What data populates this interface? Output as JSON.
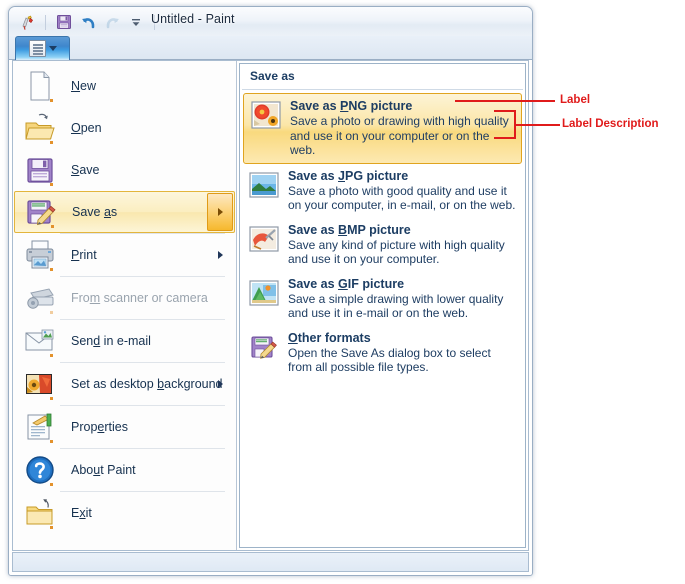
{
  "window": {
    "title": "Untitled - Paint",
    "quick_access": [
      {
        "name": "paint-app-icon",
        "glyph": "paint"
      },
      {
        "name": "save-icon",
        "glyph": "floppy"
      },
      {
        "name": "undo-icon",
        "glyph": "undo"
      },
      {
        "name": "redo-icon",
        "glyph": "redo",
        "disabled": true
      },
      {
        "name": "customize-qat-icon",
        "glyph": "chevron-down"
      }
    ]
  },
  "ribbon": {
    "paint_menu_button_label": ""
  },
  "left_menu": {
    "items": [
      {
        "label": "New",
        "accel": "N",
        "icon": "new-document-icon",
        "submenu": false,
        "disabled": false,
        "separator_after": false
      },
      {
        "label": "Open",
        "accel": "O",
        "icon": "open-folder-icon",
        "submenu": false,
        "disabled": false,
        "separator_after": false
      },
      {
        "label": "Save",
        "accel": "S",
        "icon": "floppy-disk-icon",
        "submenu": false,
        "disabled": false,
        "separator_after": false
      },
      {
        "label": "Save as",
        "accel": "a",
        "icon": "save-as-icon",
        "submenu": true,
        "disabled": false,
        "selected": true,
        "separator_after": true
      },
      {
        "label": "Print",
        "accel": "P",
        "icon": "printer-icon",
        "submenu": true,
        "disabled": false,
        "separator_after": true
      },
      {
        "label": "From scanner or camera",
        "accel": "m",
        "icon": "scanner-icon",
        "submenu": false,
        "disabled": true,
        "separator_after": true
      },
      {
        "label": "Send in e-mail",
        "accel": "d",
        "icon": "email-icon",
        "submenu": false,
        "disabled": false,
        "separator_after": true
      },
      {
        "label": "Set as desktop background",
        "accel": "b",
        "icon": "desktop-background-icon",
        "submenu": true,
        "disabled": false,
        "separator_after": true
      },
      {
        "label": "Properties",
        "accel": "e",
        "icon": "properties-icon",
        "submenu": false,
        "disabled": false,
        "separator_after": true
      },
      {
        "label": "About Paint",
        "accel": "u",
        "icon": "about-help-icon",
        "submenu": false,
        "disabled": false,
        "separator_after": true
      },
      {
        "label": "Exit",
        "accel": "x",
        "icon": "exit-folder-icon",
        "submenu": false,
        "disabled": false,
        "separator_after": false
      }
    ]
  },
  "save_as_panel": {
    "header": "Save as",
    "items": [
      {
        "title": "Save as PNG picture",
        "accel": "P",
        "description": "Save a photo or drawing with high quality and use it on your computer or on the web.",
        "icon": "png-flower-icon",
        "highlighted": true
      },
      {
        "title": "Save as JPG picture",
        "accel": "J",
        "description": "Save a photo with good quality and use it on your computer, in e-mail, or on the web.",
        "icon": "jpg-photo-icon",
        "highlighted": false
      },
      {
        "title": "Save as BMP picture",
        "accel": "B",
        "description": "Save any kind of picture with high quality and use it on your computer.",
        "icon": "bmp-paint-icon",
        "highlighted": false
      },
      {
        "title": "Save as GIF picture",
        "accel": "G",
        "description": "Save a simple drawing with lower quality and use it in e-mail or on the web.",
        "icon": "gif-drawing-icon",
        "highlighted": false
      },
      {
        "title": "Other formats",
        "accel": "O",
        "description": "Open the Save As dialog box to select from all possible file types.",
        "icon": "other-formats-icon",
        "highlighted": false
      }
    ]
  },
  "annotations": [
    {
      "name": "label-callout",
      "text": "Label"
    },
    {
      "name": "label-description-callout",
      "text": "Label Description"
    }
  ],
  "colors": {
    "accent": "#e0a41f",
    "annotation": "#e01b1b",
    "title_text": "#1b2a3e",
    "menu_text": "#16314f"
  }
}
